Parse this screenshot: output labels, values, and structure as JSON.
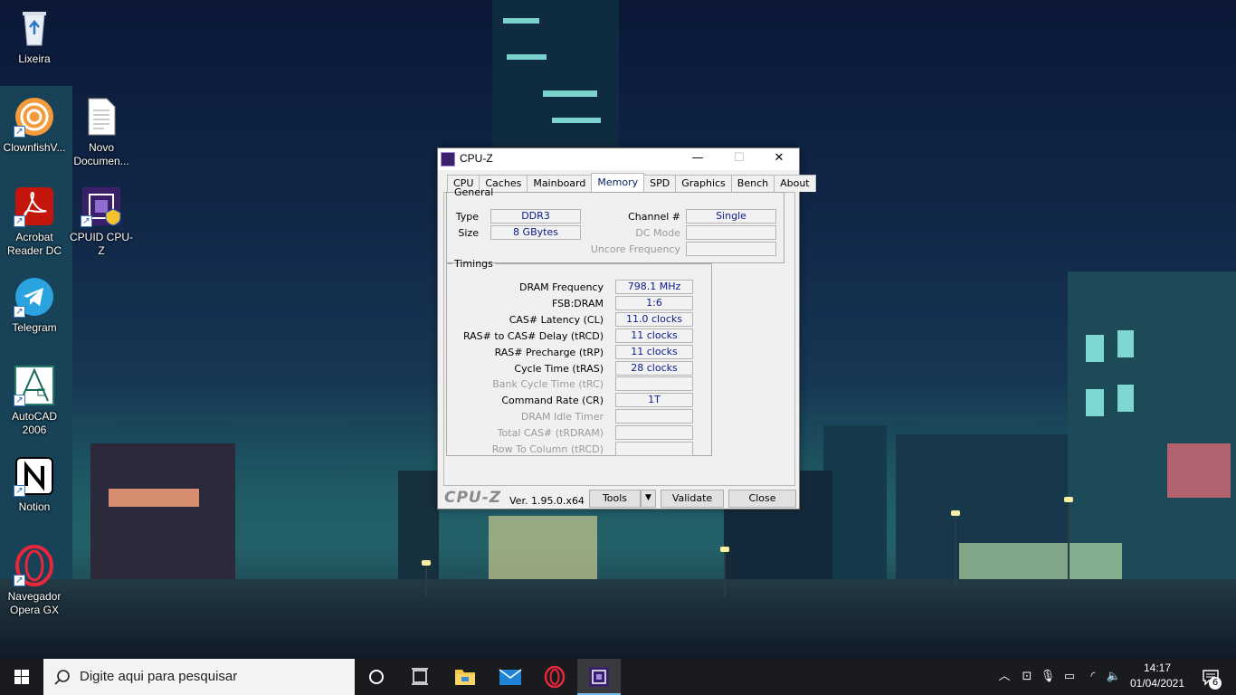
{
  "desktop": {
    "icons": [
      {
        "label": "Lixeira",
        "icon": "recycle-bin-icon"
      },
      {
        "label": "ClownfishV...",
        "icon": "clownfish-icon"
      },
      {
        "label": "Novo Documen...",
        "icon": "text-document-icon"
      },
      {
        "label": "Acrobat Reader DC",
        "icon": "acrobat-icon"
      },
      {
        "label": "CPUID CPU-Z",
        "icon": "cpuz-icon"
      },
      {
        "label": "Telegram",
        "icon": "telegram-icon"
      },
      {
        "label": "AutoCAD 2006",
        "icon": "autocad-icon"
      },
      {
        "label": "Notion",
        "icon": "notion-icon"
      },
      {
        "label": "Navegador Opera GX",
        "icon": "opera-gx-icon"
      }
    ]
  },
  "cpuz": {
    "title": "CPU-Z",
    "window_controls": {
      "minimize": "—",
      "maximize": "☐",
      "close": "✕"
    },
    "tabs": [
      "CPU",
      "Caches",
      "Mainboard",
      "Memory",
      "SPD",
      "Graphics",
      "Bench",
      "About"
    ],
    "active_tab": "Memory",
    "general": {
      "legend": "General",
      "type_label": "Type",
      "type_value": "DDR3",
      "size_label": "Size",
      "size_value": "8 GBytes",
      "channel_label": "Channel #",
      "channel_value": "Single",
      "dcmode_label": "DC Mode",
      "dcmode_value": "",
      "uncore_label": "Uncore Frequency",
      "uncore_value": ""
    },
    "timings": {
      "legend": "Timings",
      "rows": [
        {
          "label": "DRAM Frequency",
          "value": "798.1 MHz",
          "enabled": true
        },
        {
          "label": "FSB:DRAM",
          "value": "1:6",
          "enabled": true
        },
        {
          "label": "CAS# Latency (CL)",
          "value": "11.0 clocks",
          "enabled": true
        },
        {
          "label": "RAS# to CAS# Delay (tRCD)",
          "value": "11 clocks",
          "enabled": true
        },
        {
          "label": "RAS# Precharge (tRP)",
          "value": "11 clocks",
          "enabled": true
        },
        {
          "label": "Cycle Time (tRAS)",
          "value": "28 clocks",
          "enabled": true
        },
        {
          "label": "Bank Cycle Time (tRC)",
          "value": "",
          "enabled": false
        },
        {
          "label": "Command Rate (CR)",
          "value": "1T",
          "enabled": true
        },
        {
          "label": "DRAM Idle Timer",
          "value": "",
          "enabled": false
        },
        {
          "label": "Total CAS# (tRDRAM)",
          "value": "",
          "enabled": false
        },
        {
          "label": "Row To Column (tRCD)",
          "value": "",
          "enabled": false
        }
      ]
    },
    "footer": {
      "logo": "CPU-Z",
      "version": "Ver. 1.95.0.x64",
      "tools_label": "Tools",
      "validate_label": "Validate",
      "close_label": "Close"
    }
  },
  "taskbar": {
    "search_placeholder": "Digite aqui para pesquisar",
    "pinned": [
      "start-icon",
      "cortana-icon",
      "task-view-icon",
      "file-explorer-icon",
      "mail-icon",
      "opera-gx-icon",
      "cpuz-icon"
    ],
    "time": "14:17",
    "date": "01/04/2021",
    "notification_count": "6"
  },
  "colors": {
    "accent": "#0a246a",
    "value_text": "#0a1a8a",
    "taskbar": "#1a1b1e"
  }
}
